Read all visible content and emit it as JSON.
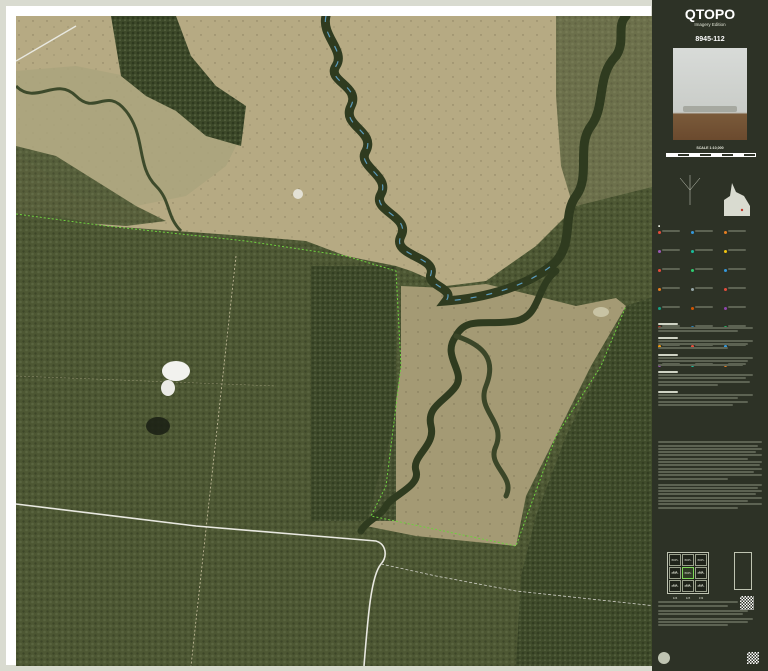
{
  "panel": {
    "title": "QTOPO",
    "subtitle": "Imagery Edition",
    "map_number": "8945-112",
    "scale": "SCALE 1:10,000"
  },
  "map": {
    "colors": {
      "woodland": "#4f5a35",
      "paddock_light": "#b9ad86",
      "paddock_mid": "#a89d77",
      "river": "#2f3b1f",
      "water": "#5b9bbd",
      "road": "#e8e8e0",
      "boundary": "#6fcf3f"
    }
  },
  "index": {
    "sheets": [
      "8945-114",
      "8945-121",
      "8945-122",
      "8945-111",
      "8945-112",
      "8945-113",
      "8945-124",
      "8945-123",
      "8945-132"
    ]
  },
  "footer": {
    "qr_label": "QR"
  }
}
